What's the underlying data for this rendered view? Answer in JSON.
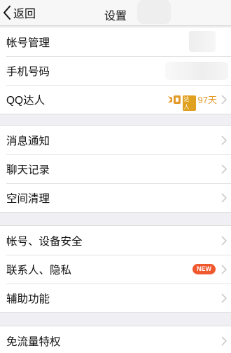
{
  "nav": {
    "back_label": "返回",
    "title": "设置"
  },
  "groups": [
    {
      "items": [
        {
          "label": "帐号管理"
        },
        {
          "label": "手机号码"
        },
        {
          "label": "QQ达人",
          "badge_text": "达人",
          "days": "97天"
        }
      ]
    },
    {
      "items": [
        {
          "label": "消息通知"
        },
        {
          "label": "聊天记录"
        },
        {
          "label": "空间清理"
        }
      ]
    },
    {
      "items": [
        {
          "label": "帐号、设备安全"
        },
        {
          "label": "联系人、隐私",
          "new_badge": "NEW"
        },
        {
          "label": "辅助功能"
        }
      ]
    },
    {
      "items": [
        {
          "label": "免流量特权"
        }
      ]
    }
  ],
  "colors": {
    "badge_gold": "#e39a2a",
    "new_badge_bg": "#f0582e",
    "background": "#efeff4"
  },
  "icons": {
    "back": "chevron-left-icon",
    "row_arrow": "chevron-right-icon",
    "daren": "crown-badge-icon"
  }
}
